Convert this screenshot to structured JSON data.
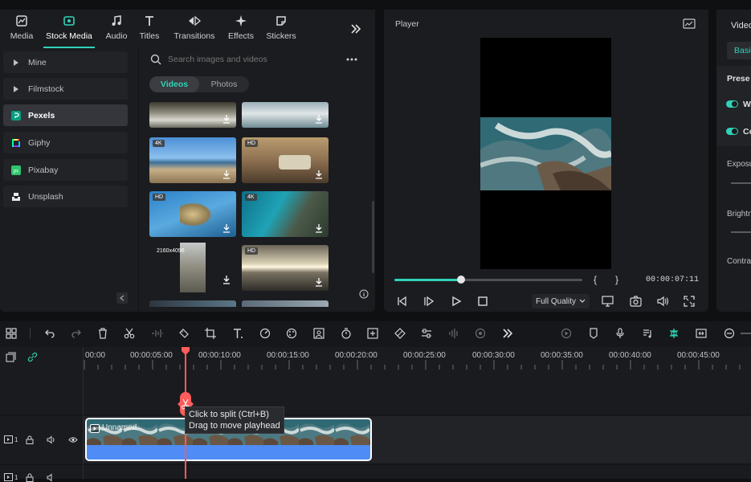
{
  "media_tabs": [
    {
      "label": "Media",
      "icon": "media-icon"
    },
    {
      "label": "Stock Media",
      "icon": "stock-media-icon",
      "active": true
    },
    {
      "label": "Audio",
      "icon": "music-note-icon"
    },
    {
      "label": "Titles",
      "icon": "text-t-icon"
    },
    {
      "label": "Transitions",
      "icon": "transition-icon"
    },
    {
      "label": "Effects",
      "icon": "sparkle-icon"
    },
    {
      "label": "Stickers",
      "icon": "sticker-icon"
    }
  ],
  "sidebar": {
    "items": [
      {
        "label": "Mine",
        "icon": "triangle-right-icon"
      },
      {
        "label": "Filmstock",
        "icon": "triangle-right-icon"
      },
      {
        "label": "Pexels",
        "icon": "pexels-logo-icon",
        "active": true
      },
      {
        "label": "Giphy",
        "icon": "giphy-logo-icon"
      },
      {
        "label": "Pixabay",
        "icon": "pixabay-logo-icon"
      },
      {
        "label": "Unsplash",
        "icon": "unsplash-logo-icon"
      }
    ]
  },
  "search": {
    "placeholder": "Search images and videos"
  },
  "segmented": {
    "videos": "Videos",
    "photos": "Photos",
    "active": "Videos"
  },
  "thumbnails": [
    {
      "badge": "",
      "scene": "waterfall"
    },
    {
      "badge": "",
      "scene": "waves"
    },
    {
      "badge": "4K",
      "scene": "beach"
    },
    {
      "badge": "HD",
      "scene": "van-sunset"
    },
    {
      "badge": "HD",
      "scene": "palm-sky"
    },
    {
      "badge": "4K",
      "scene": "aerial-coast"
    },
    {
      "badge": "2160x4096",
      "scene": "couple-car"
    },
    {
      "badge": "HD",
      "scene": "grass-sunset"
    }
  ],
  "player": {
    "title": "Player",
    "timecode": "00:00:07:11",
    "progress": 0.355,
    "quality": "Full Quality",
    "brace_open": "{",
    "brace_close": "}"
  },
  "right_panel": {
    "header": "Video",
    "basic_tab": "Basic",
    "preset_label": "Prese",
    "toggle1": "W",
    "toggle2": "Co",
    "exposure": "Exposu",
    "brightness": "Brightn",
    "contrast": "Contra"
  },
  "timeline": {
    "ruler_labels": [
      "00:00",
      "00:00:05:00",
      "00:00:10:00",
      "00:00:15:00",
      "00:00:20:00",
      "00:00:25:00",
      "00:00:30:00",
      "00:00:35:00",
      "00:00:40:00",
      "00:00:45:00"
    ],
    "clip_name": "Unnamed",
    "tooltip_line1": "Click to split (Ctrl+B)",
    "tooltip_line2": "Drag to move playhead",
    "track1_number": "1",
    "track2_number": "1"
  },
  "colors": {
    "accent": "#2fd3b8",
    "playhead": "#ff5c5c",
    "clip_blue": "#3d7cf2",
    "panel_bg": "#1b1c1f"
  }
}
